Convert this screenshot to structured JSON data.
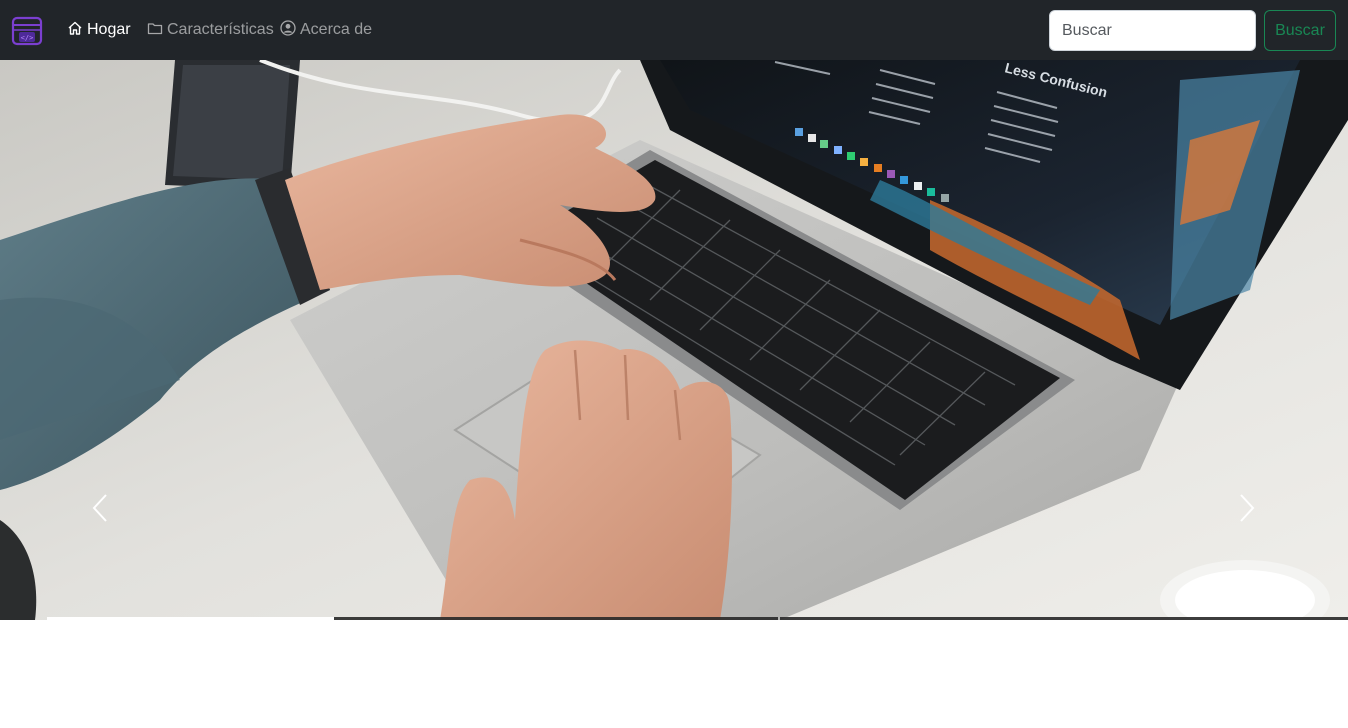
{
  "nav": {
    "brand_icon": "code-window-icon",
    "links": [
      {
        "label": "Hogar",
        "icon": "house-icon",
        "active": true
      },
      {
        "label": "Características",
        "icon": "folder-icon",
        "active": false
      },
      {
        "label": "Acerca de",
        "icon": "person-circle-icon",
        "active": false
      }
    ]
  },
  "search": {
    "placeholder": "Buscar",
    "value": "",
    "button_label": "Buscar"
  },
  "carousel": {
    "image_subject": "hands typing on a laptop keyboard",
    "screen_heading": "Less Confusion",
    "prev_icon": "chevron-left-icon",
    "next_icon": "chevron-right-icon",
    "slide_count": 3,
    "active_slide": 1
  },
  "colors": {
    "navbar_bg": "#212529",
    "brand_purple": "#7b3fd0",
    "search_button": "#198754"
  }
}
